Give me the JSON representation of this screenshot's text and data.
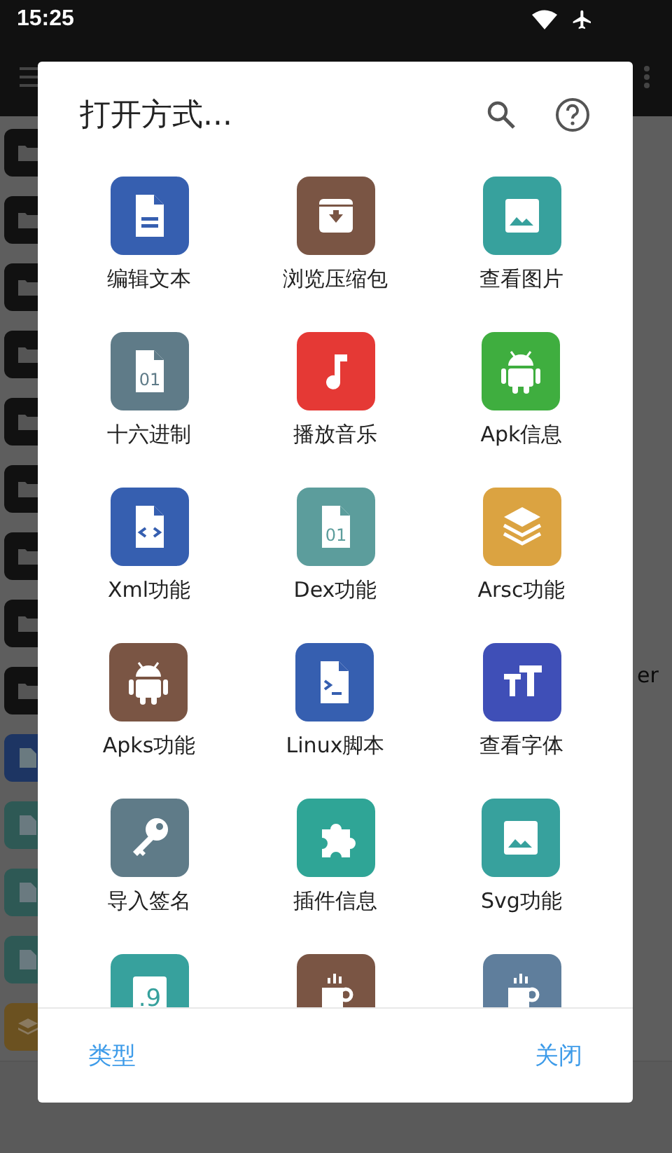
{
  "status_bar": {
    "time": "15:25"
  },
  "background": {
    "rows": [
      {
        "kind": "folder",
        "color": "#111111"
      },
      {
        "kind": "folder",
        "color": "#111111"
      },
      {
        "kind": "folder",
        "color": "#111111"
      },
      {
        "kind": "folder",
        "color": "#111111"
      },
      {
        "kind": "folder",
        "color": "#111111"
      },
      {
        "kind": "folder",
        "color": "#111111"
      },
      {
        "kind": "folder",
        "color": "#111111"
      },
      {
        "kind": "folder",
        "color": "#111111"
      },
      {
        "kind": "folder",
        "color": "#111111"
      },
      {
        "kind": "code",
        "color": "#1d3563"
      },
      {
        "kind": "hex",
        "color": "#2e5955"
      },
      {
        "kind": "hex",
        "color": "#2e5955"
      },
      {
        "kind": "hex",
        "color": "#2e5955"
      },
      {
        "kind": "layers",
        "color": "#6b5120"
      }
    ],
    "partial_text": "er"
  },
  "dialog": {
    "title": "打开方式...",
    "apps": [
      {
        "label": "编辑文本",
        "kind": "doc",
        "color": "#365fb0"
      },
      {
        "label": "浏览压缩包",
        "kind": "archive",
        "color": "#7a5544"
      },
      {
        "label": "查看图片",
        "kind": "image",
        "color": "#37a19d"
      },
      {
        "label": "十六进制",
        "kind": "hex",
        "color": "#5f7b88",
        "glyph": "01"
      },
      {
        "label": "播放音乐",
        "kind": "music",
        "color": "#e53935"
      },
      {
        "label": "Apk信息",
        "kind": "android",
        "color": "#3fae3f"
      },
      {
        "label": "Xml功能",
        "kind": "code",
        "color": "#365fb0"
      },
      {
        "label": "Dex功能",
        "kind": "hex",
        "color": "#5c9d9c",
        "glyph": "01"
      },
      {
        "label": "Arsc功能",
        "kind": "layers",
        "color": "#dba341"
      },
      {
        "label": "Apks功能",
        "kind": "android",
        "color": "#7a5544"
      },
      {
        "label": "Linux脚本",
        "kind": "terminal",
        "color": "#365fb0"
      },
      {
        "label": "查看字体",
        "kind": "font",
        "color": "#3f4fb7"
      },
      {
        "label": "导入签名",
        "kind": "key",
        "color": "#5f7b88"
      },
      {
        "label": "插件信息",
        "kind": "puzzle",
        "color": "#2fa596"
      },
      {
        "label": "Svg功能",
        "kind": "image",
        "color": "#37a19d"
      },
      {
        "kind": "ninepatch",
        "color": "#37a19d",
        "glyph": ".9"
      },
      {
        "kind": "cup",
        "color": "#7a5544"
      },
      {
        "kind": "cup",
        "color": "#5f7e9c"
      }
    ],
    "buttons": [
      {
        "label": "类型"
      },
      {
        "label": "关闭"
      }
    ]
  }
}
